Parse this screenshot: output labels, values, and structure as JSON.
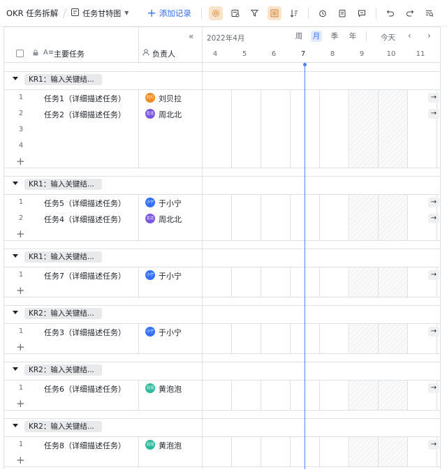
{
  "toolbar": {
    "title": "OKR 任务拆解",
    "view_name": "任务甘特图",
    "add_label": "添加记录",
    "icons": [
      "settings-icon",
      "field-config-icon",
      "filter-icon",
      "group-icon",
      "sort-icon",
      "reminder-icon",
      "form-icon",
      "comment-icon",
      "undo-icon",
      "redo-icon",
      "search-icon"
    ]
  },
  "columns": {
    "main": "主要任务",
    "owner": "负责人"
  },
  "timeline": {
    "month": "2022年4月",
    "scales": [
      "周",
      "月",
      "季",
      "年"
    ],
    "active_scale": "月",
    "today_label": "今天",
    "prev": "‹",
    "next": "›",
    "days": [
      "4",
      "5",
      "6",
      "7",
      "8",
      "9",
      "10",
      "11"
    ],
    "current_day": "7",
    "end_arrow": "→"
  },
  "groups": [
    {
      "label": "KR1：输入关键结...",
      "rows": [
        {
          "num": "1",
          "name": "任务1（详细描述任务）",
          "owner": "刘贝拉",
          "avatar": "刘贝",
          "color": "#f08b24"
        },
        {
          "num": "2",
          "name": "任务2（详细描述任务）",
          "owner": "周北北",
          "avatar": "北北",
          "color": "#7b57e0"
        },
        {
          "num": "3",
          "name": "",
          "owner": "",
          "avatar": "",
          "color": ""
        },
        {
          "num": "4",
          "name": "",
          "owner": "",
          "avatar": "",
          "color": ""
        }
      ]
    },
    {
      "label": "KR1：输入关键结...",
      "rows": [
        {
          "num": "1",
          "name": "任务5（详细描述任务）",
          "owner": "于小宁",
          "avatar": "小宁",
          "color": "#3370ff"
        },
        {
          "num": "2",
          "name": "任务4（详细描述任务）",
          "owner": "周北北",
          "avatar": "北北",
          "color": "#7b57e0"
        }
      ]
    },
    {
      "label": "KR1：输入关键结...",
      "rows": [
        {
          "num": "1",
          "name": "任务7（详细描述任务）",
          "owner": "于小宁",
          "avatar": "小宁",
          "color": "#3370ff"
        }
      ]
    },
    {
      "label": "KR2：输入关键结...",
      "rows": [
        {
          "num": "1",
          "name": "任务3（详细描述任务）",
          "owner": "于小宁",
          "avatar": "小宁",
          "color": "#3370ff"
        }
      ]
    },
    {
      "label": "KR2：输入关键结...",
      "rows": [
        {
          "num": "1",
          "name": "任务6（详细描述任务）",
          "owner": "黄泡泡",
          "avatar": "泡泡",
          "color": "#2eb89c"
        }
      ]
    },
    {
      "label": "KR2：输入关键结...",
      "rows": [
        {
          "num": "1",
          "name": "任务8（详细描述任务）",
          "owner": "黄泡泡",
          "avatar": "泡泡",
          "color": "#2eb89c"
        }
      ]
    }
  ]
}
